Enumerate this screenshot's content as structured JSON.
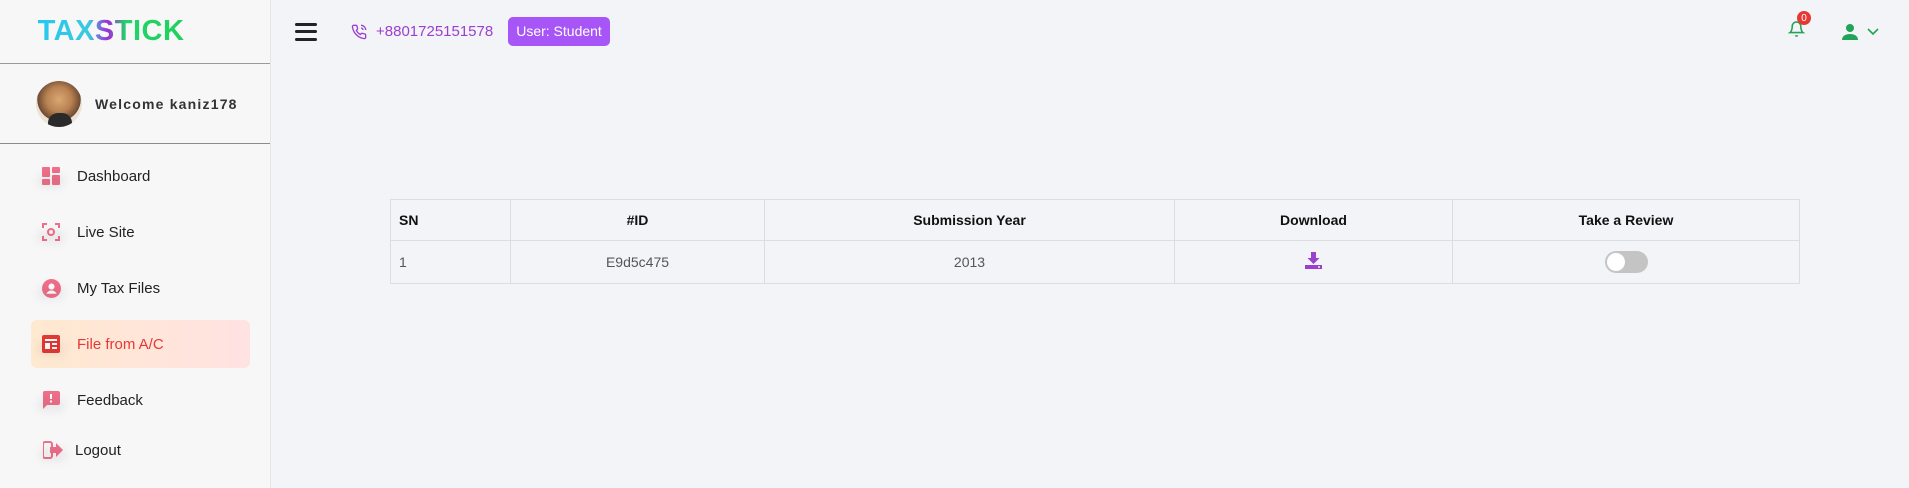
{
  "brand": {
    "logo_text": "TAXSTICK"
  },
  "sidebar": {
    "welcome": "Welcome kaniz178",
    "items": [
      {
        "label": "Dashboard",
        "icon": "dashboard-icon"
      },
      {
        "label": "Live Site",
        "icon": "live-site-icon"
      },
      {
        "label": "My Tax Files",
        "icon": "account-icon"
      },
      {
        "label": "File from A/C",
        "icon": "file-icon",
        "active": true
      },
      {
        "label": "Feedback",
        "icon": "feedback-icon"
      }
    ],
    "logout": "Logout"
  },
  "topbar": {
    "phone": "+8801725151578",
    "user_badge": "User:  Student",
    "notification_count": "0"
  },
  "table": {
    "headers": {
      "sn": "SN",
      "id": "#ID",
      "year": "Submission Year",
      "download": "Download",
      "review": "Take a Review"
    },
    "rows": [
      {
        "sn": "1",
        "id": "E9d5c475",
        "year": "2013",
        "review_enabled": false
      }
    ]
  },
  "colors": {
    "accent": "#a855f7",
    "active": "#e53935",
    "icon_pink": "#f06f8a",
    "bell": "#22a35a"
  }
}
